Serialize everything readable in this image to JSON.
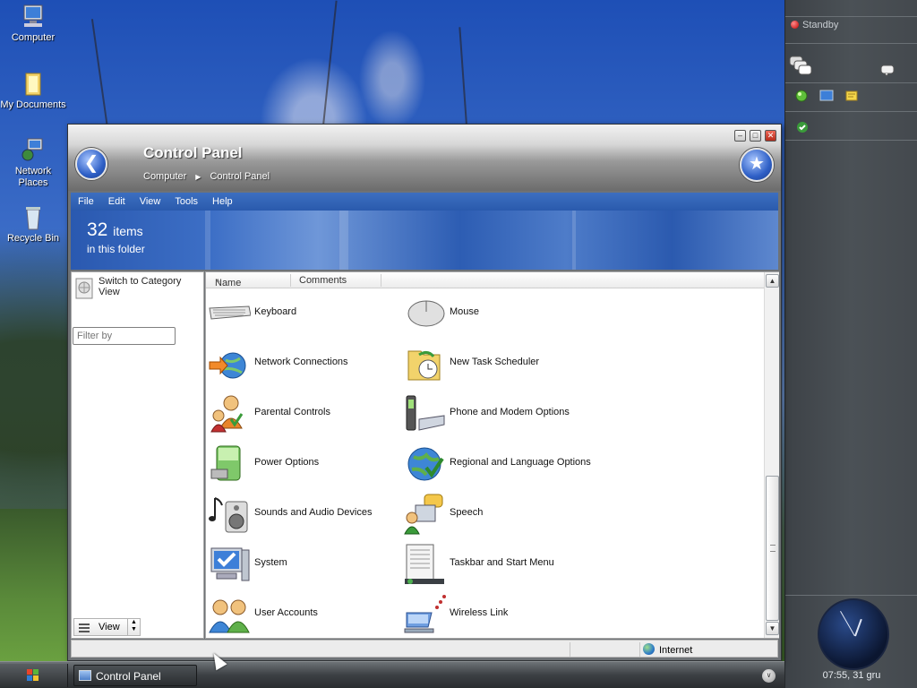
{
  "desktop": {
    "icons": [
      {
        "label": "Computer",
        "icon": "computer-icon"
      },
      {
        "label": "My Documents",
        "icon": "folder-icon"
      },
      {
        "label": "Network Places",
        "icon": "network-icon"
      },
      {
        "label": "Recycle Bin",
        "icon": "recycle-bin-icon"
      }
    ]
  },
  "sidebar": {
    "standby": "Standby",
    "clock": "07:55, 31 gru"
  },
  "window": {
    "title": "Control Panel",
    "breadcrumb": [
      "Computer",
      "Control Panel"
    ],
    "menu": [
      "File",
      "Edit",
      "View",
      "Tools",
      "Help"
    ],
    "banner": {
      "count": "32",
      "count_unit": "items",
      "subtitle": "in this folder"
    },
    "left": {
      "switch_view": "Switch to Category View",
      "filter_placeholder": "Filter by",
      "view_label": "View"
    },
    "columns": {
      "name": "Name",
      "comments": "Comments"
    },
    "items": [
      {
        "name": "Keyboard",
        "icon": "keyboard-icon"
      },
      {
        "name": "Mouse",
        "icon": "mouse-icon"
      },
      {
        "name": "Network Connections",
        "icon": "network-connections-icon"
      },
      {
        "name": "New Task Scheduler",
        "icon": "task-scheduler-icon"
      },
      {
        "name": "Parental Controls",
        "icon": "parental-controls-icon"
      },
      {
        "name": "Phone and Modem Options",
        "icon": "phone-modem-icon"
      },
      {
        "name": "Power Options",
        "icon": "power-options-icon"
      },
      {
        "name": "Regional and Language Options",
        "icon": "regional-language-icon"
      },
      {
        "name": "Sounds and Audio Devices",
        "icon": "sounds-audio-icon"
      },
      {
        "name": "Speech",
        "icon": "speech-icon"
      },
      {
        "name": "System",
        "icon": "system-icon"
      },
      {
        "name": "Taskbar and Start Menu",
        "icon": "taskbar-start-menu-icon"
      },
      {
        "name": "User Accounts",
        "icon": "user-accounts-icon"
      },
      {
        "name": "Wireless Link",
        "icon": "wireless-link-icon"
      }
    ],
    "status": {
      "zone": "Internet"
    }
  },
  "taskbar": {
    "task_label": "Control Panel"
  },
  "colors": {
    "accent_blue": "#2a5aad",
    "window_gray": "#6e7276",
    "sidebar_dark": "#44494e"
  }
}
